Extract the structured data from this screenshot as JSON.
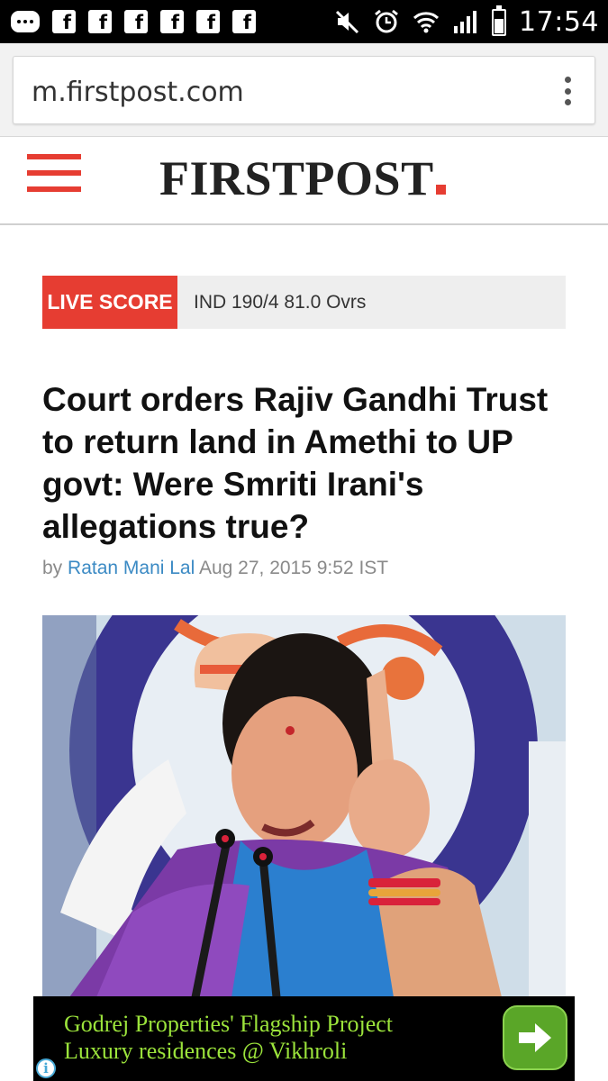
{
  "status_bar": {
    "time": "17:54",
    "notification_icons": [
      "chat-icon",
      "facebook-icon",
      "facebook-icon",
      "facebook-icon",
      "facebook-icon",
      "facebook-icon",
      "facebook-icon"
    ],
    "facebook_glyph": "f",
    "system_icons": [
      "mute-icon",
      "alarm-icon",
      "wifi-icon",
      "signal-icon",
      "battery-icon"
    ]
  },
  "browser": {
    "url": "m.firstpost.com"
  },
  "site_header": {
    "logo_text": "FIRSTPOST",
    "accent_color": "#e63d32"
  },
  "live_score": {
    "label": "LIVE SCORE",
    "text": "IND 190/4 81.0 Ovrs"
  },
  "article": {
    "headline": "Court orders Rajiv Gandhi Trust to return land in Amethi to UP govt: Were Smriti Irani's allegations true?",
    "byline_prefix": "by",
    "author": "Ratan Mani Lal",
    "date": "Aug 27, 2015 9:52 IST"
  },
  "ad": {
    "line1": "Godrej Properties' Flagship Project",
    "line2": "Luxury residences @ Vikhroli",
    "text_color": "#9be33b",
    "info_glyph": "i"
  }
}
